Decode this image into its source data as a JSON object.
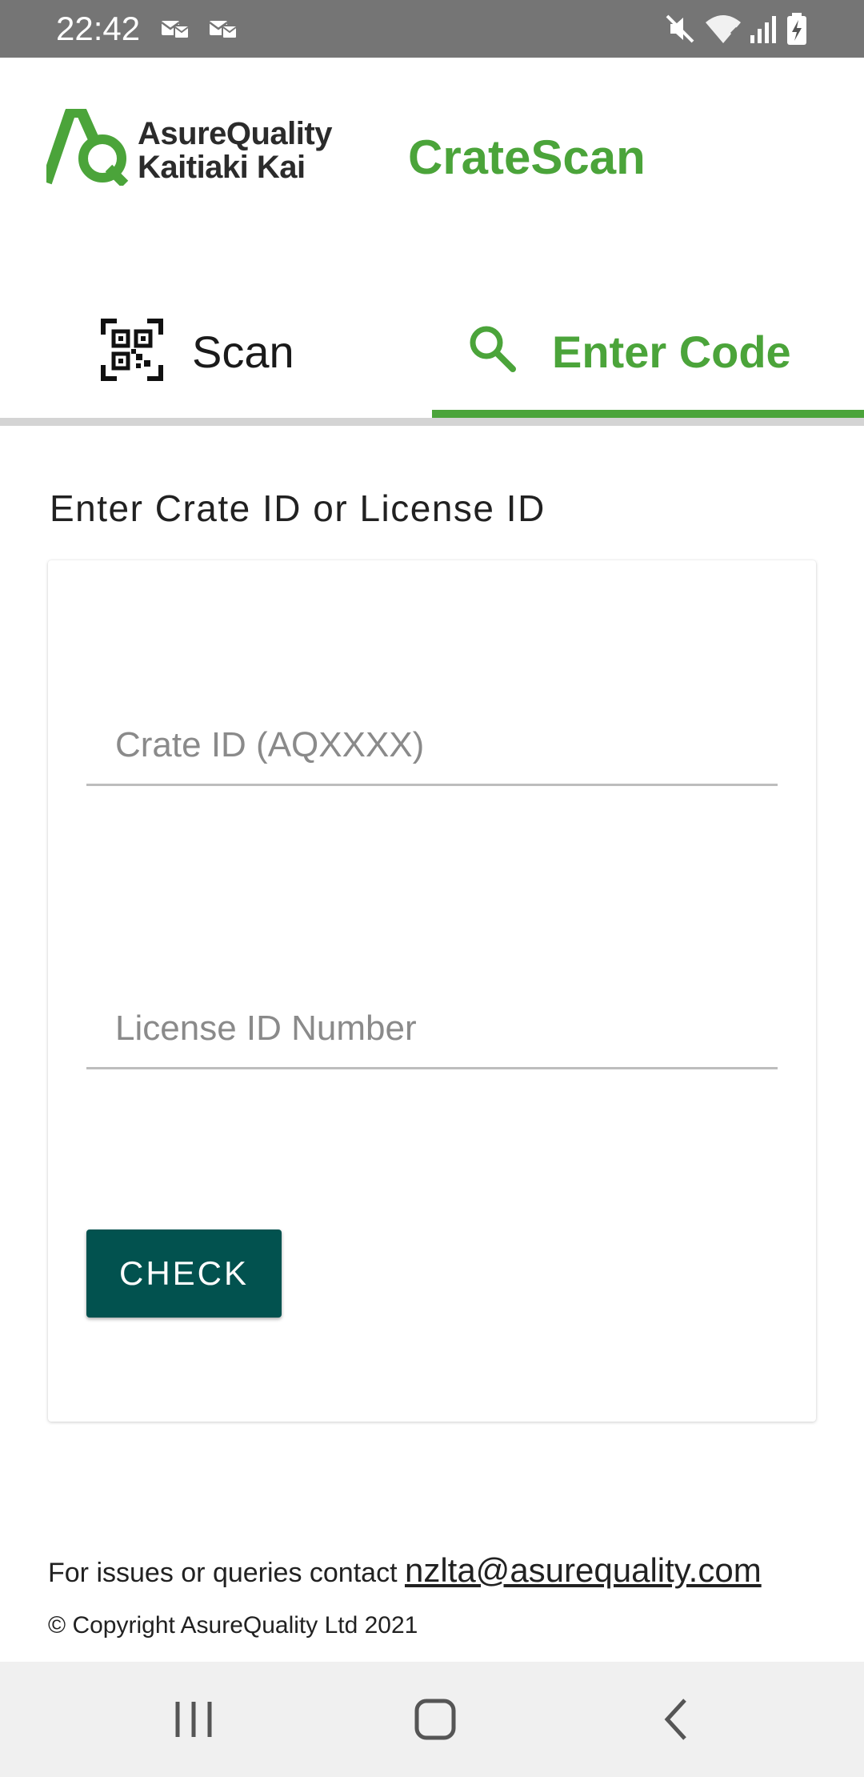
{
  "status_bar": {
    "time": "22:42",
    "left_icons": [
      "mail-notification-icon",
      "mail-notification-icon"
    ],
    "right_icons": [
      "mute-icon",
      "wifi-icon",
      "signal-icon",
      "battery-charging-icon"
    ]
  },
  "header": {
    "logo": {
      "line1": "AsureQuality",
      "line2": "Kaitiaki Kai",
      "mark_icon": "aq-logo-icon"
    },
    "app_title": "CrateScan"
  },
  "tabs": [
    {
      "label": "Scan",
      "icon": "qr-code-icon",
      "active": false
    },
    {
      "label": "Enter Code",
      "icon": "search-icon",
      "active": true
    }
  ],
  "form": {
    "section_label": "Enter Crate ID or License ID",
    "crate_field": {
      "placeholder": "Crate ID (AQXXXX)",
      "value": ""
    },
    "license_field": {
      "placeholder": "License ID Number",
      "value": ""
    },
    "check_button": "CHECK"
  },
  "footer": {
    "contact_text": "For issues or queries contact ",
    "contact_email": "nzlta@asurequality.com",
    "copyright": "© Copyright AsureQuality Ltd 2021"
  },
  "colors": {
    "accent_green": "#4ba43a",
    "button_teal": "#02524f",
    "status_bar": "#757575"
  },
  "nav_bar": [
    "recent-apps-icon",
    "home-icon",
    "back-icon"
  ]
}
